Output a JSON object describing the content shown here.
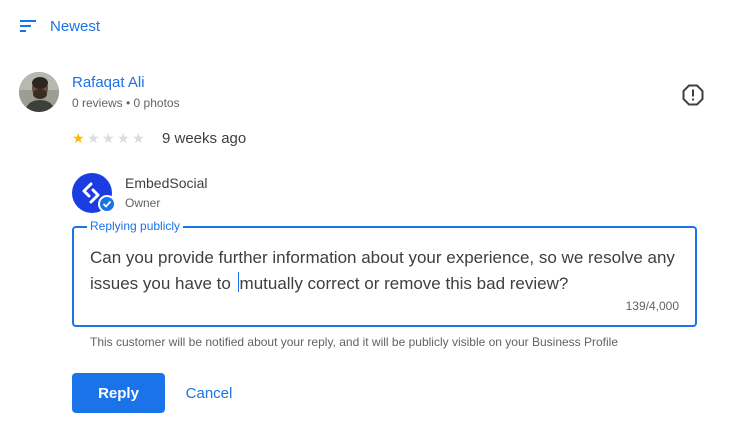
{
  "sort": {
    "label": "Newest",
    "icon": "sort-icon"
  },
  "review": {
    "reviewer_name": "Rafaqat Ali",
    "reviewer_meta": "0 reviews • 0 photos",
    "rating": 1,
    "max_rating": 5,
    "time_ago": "9 weeks ago",
    "flag_icon": "report-icon"
  },
  "owner": {
    "name": "EmbedSocial",
    "role": "Owner",
    "brand_color": "#1a3ce0"
  },
  "reply": {
    "label": "Replying publicly",
    "text_before_cursor": "Can you provide further information about your experience, so we resolve any issues you have to ",
    "text_after_cursor": "mutually correct or remove this bad review?",
    "counter": "139/4,000",
    "notice": "This customer will be notified about your reply, and it will be publicly visible on your Business Profile"
  },
  "actions": {
    "reply_label": "Reply",
    "cancel_label": "Cancel"
  },
  "colors": {
    "accent": "#1a73e8",
    "star": "#fbbc04",
    "star_empty": "#dadce0"
  }
}
